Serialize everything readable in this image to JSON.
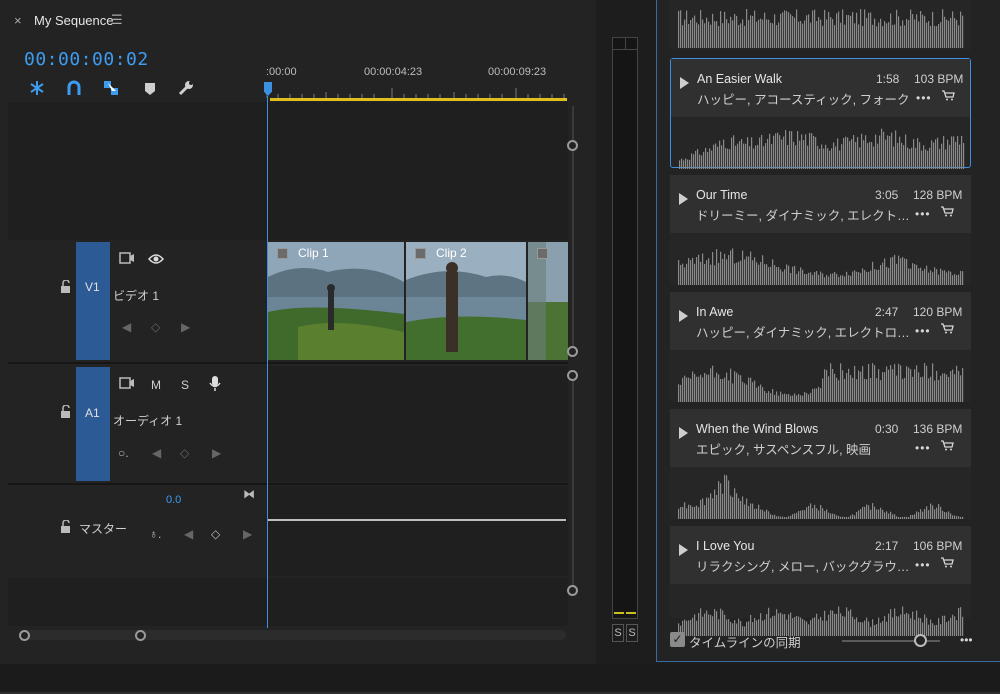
{
  "sequence": {
    "close_glyph": "×",
    "title": "My Sequence",
    "menu_glyph": "☰",
    "timecode": "00:00:00:02",
    "ruler_labels": [
      ":00:00",
      "00:00:04:23",
      "00:00:09:23"
    ]
  },
  "tools": [
    {
      "name": "insert-edit-icon"
    },
    {
      "name": "snap-magnet-icon"
    },
    {
      "name": "linked-selection-icon"
    },
    {
      "name": "add-marker-icon"
    },
    {
      "name": "wrench-icon"
    }
  ],
  "tracks": {
    "v1": {
      "id": "V1",
      "name": "ビデオ 1"
    },
    "a1": {
      "id": "A1",
      "name": "オーディオ 1",
      "mute": "M",
      "solo": "S"
    },
    "master": {
      "name": "マスター",
      "level": "0.0"
    }
  },
  "clips": [
    {
      "label": "Clip 1"
    },
    {
      "label": "Clip 2"
    }
  ],
  "meter": {
    "solo_left": "S",
    "solo_right": "S"
  },
  "songs": [
    {
      "title": "An Easier Walk",
      "duration": "1:58",
      "bpm": "103 BPM",
      "tags": "ハッピー, アコースティック, フォーク",
      "selected": true
    },
    {
      "title": "Our Time",
      "duration": "3:05",
      "bpm": "128 BPM",
      "tags": "ドリーミー, ダイナミック, エレクト…",
      "selected": false
    },
    {
      "title": "In Awe",
      "duration": "2:47",
      "bpm": "120 BPM",
      "tags": "ハッピー, ダイナミック, エレクトロ…",
      "selected": false
    },
    {
      "title": "When the Wind Blows",
      "duration": "0:30",
      "bpm": "136 BPM",
      "tags": "エピック, サスペンスフル, 映画",
      "selected": false
    },
    {
      "title": "I Love You",
      "duration": "2:17",
      "bpm": "106 BPM",
      "tags": "リラクシング, メロー, バックグラウ…",
      "selected": false
    }
  ],
  "footer": {
    "sync_label": "タイムラインの同期",
    "sync_checked": true,
    "more_glyph": "•••"
  },
  "colors": {
    "accent": "#3d9cf0",
    "track_header": "#2b5a94",
    "work_area": "#e0c01e",
    "selected_border": "#3d8fe0"
  }
}
